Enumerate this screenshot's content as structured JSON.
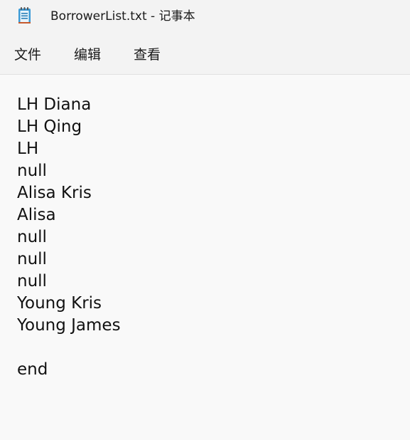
{
  "window": {
    "title": "BorrowerList.txt - 记事本",
    "icon": "notepad-icon"
  },
  "menu": {
    "file": "文件",
    "edit": "编辑",
    "view": "查看"
  },
  "document": {
    "lines": [
      "LH Diana",
      "LH Qing",
      "LH",
      "null",
      "Alisa Kris",
      "Alisa",
      "null",
      "null",
      "null",
      "Young Kris",
      "Young James",
      "",
      "end"
    ]
  }
}
